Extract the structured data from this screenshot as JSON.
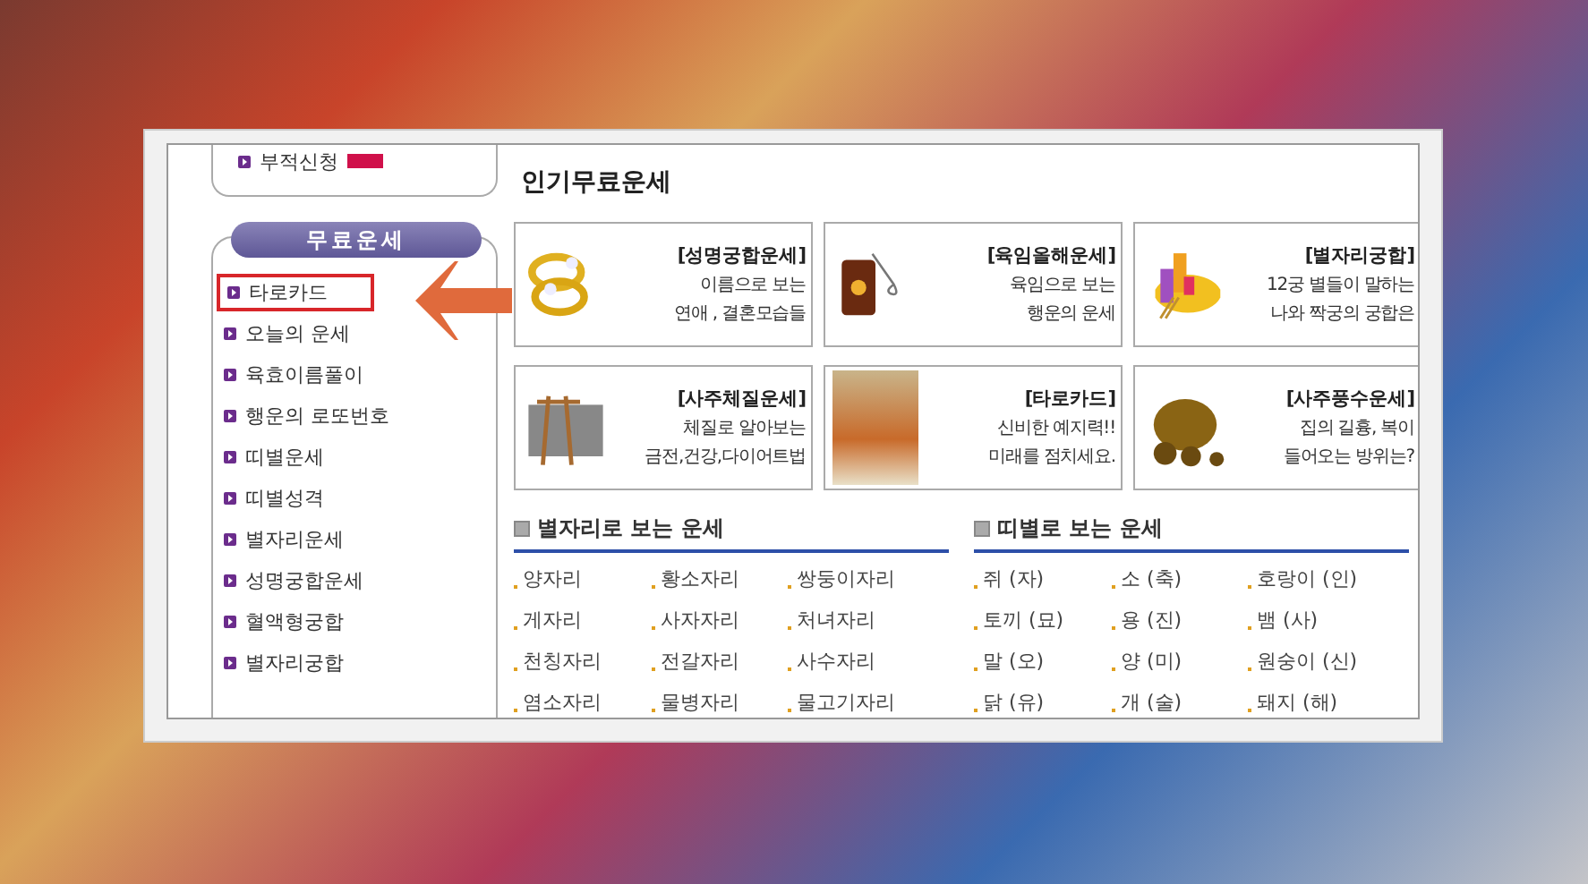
{
  "sidebar": {
    "top_item": {
      "label": "부적신청"
    },
    "menu_title": "무료운세",
    "items": [
      {
        "label": "타로카드",
        "highlighted": true
      },
      {
        "label": "오늘의 운세",
        "highlighted": false
      },
      {
        "label": "육효이름풀이",
        "highlighted": false
      },
      {
        "label": "행운의 로또번호",
        "highlighted": false
      },
      {
        "label": "띠별운세",
        "highlighted": false
      },
      {
        "label": "띠별성격",
        "highlighted": false
      },
      {
        "label": "별자리운세",
        "highlighted": false
      },
      {
        "label": "성명궁합운세",
        "highlighted": false
      },
      {
        "label": "혈액형궁합",
        "highlighted": false
      },
      {
        "label": "별자리궁합",
        "highlighted": false
      }
    ]
  },
  "main": {
    "title": "인기무료운세",
    "cards": [
      {
        "kind": "rings",
        "title": "[성명궁합운세]",
        "lines": [
          "이름으로 보는",
          "연애 , 결혼모습들"
        ]
      },
      {
        "kind": "lantern",
        "title": "[육임올해운세]",
        "lines": [
          "육임으로 보는",
          "행운의 운세"
        ]
      },
      {
        "kind": "candles",
        "title": "[별자리궁합]",
        "lines": [
          "12궁 별들이 말하는",
          "나와 짝궁의 궁합은"
        ]
      },
      {
        "kind": "easel",
        "title": "[사주체질운세]",
        "lines": [
          "체질로 알아보는",
          "금전,건강,다이어트법"
        ]
      },
      {
        "kind": "tarot",
        "title": "[타로카드]",
        "lines": [
          "신비한 예지력!!",
          "미래를 점치세요."
        ]
      },
      {
        "kind": "pots",
        "title": "[사주풍수운세]",
        "lines": [
          "집의 길흉, 복이",
          "들어오는 방위는?"
        ]
      }
    ],
    "sections": [
      {
        "title": "별자리로 보는 운세",
        "items": [
          "양자리",
          "황소자리",
          "쌍둥이자리",
          "게자리",
          "사자자리",
          "처녀자리",
          "천칭자리",
          "전갈자리",
          "사수자리",
          "염소자리",
          "물병자리",
          "물고기자리"
        ]
      },
      {
        "title": "띠별로 보는 운세",
        "items": [
          "쥐 (자)",
          "소 (축)",
          "호랑이 (인)",
          "토끼 (묘)",
          "용 (진)",
          "뱀 (사)",
          "말 (오)",
          "양 (미)",
          "원숭이 (신)",
          "닭 (유)",
          "개 (술)",
          "돼지 (해)"
        ]
      }
    ]
  }
}
